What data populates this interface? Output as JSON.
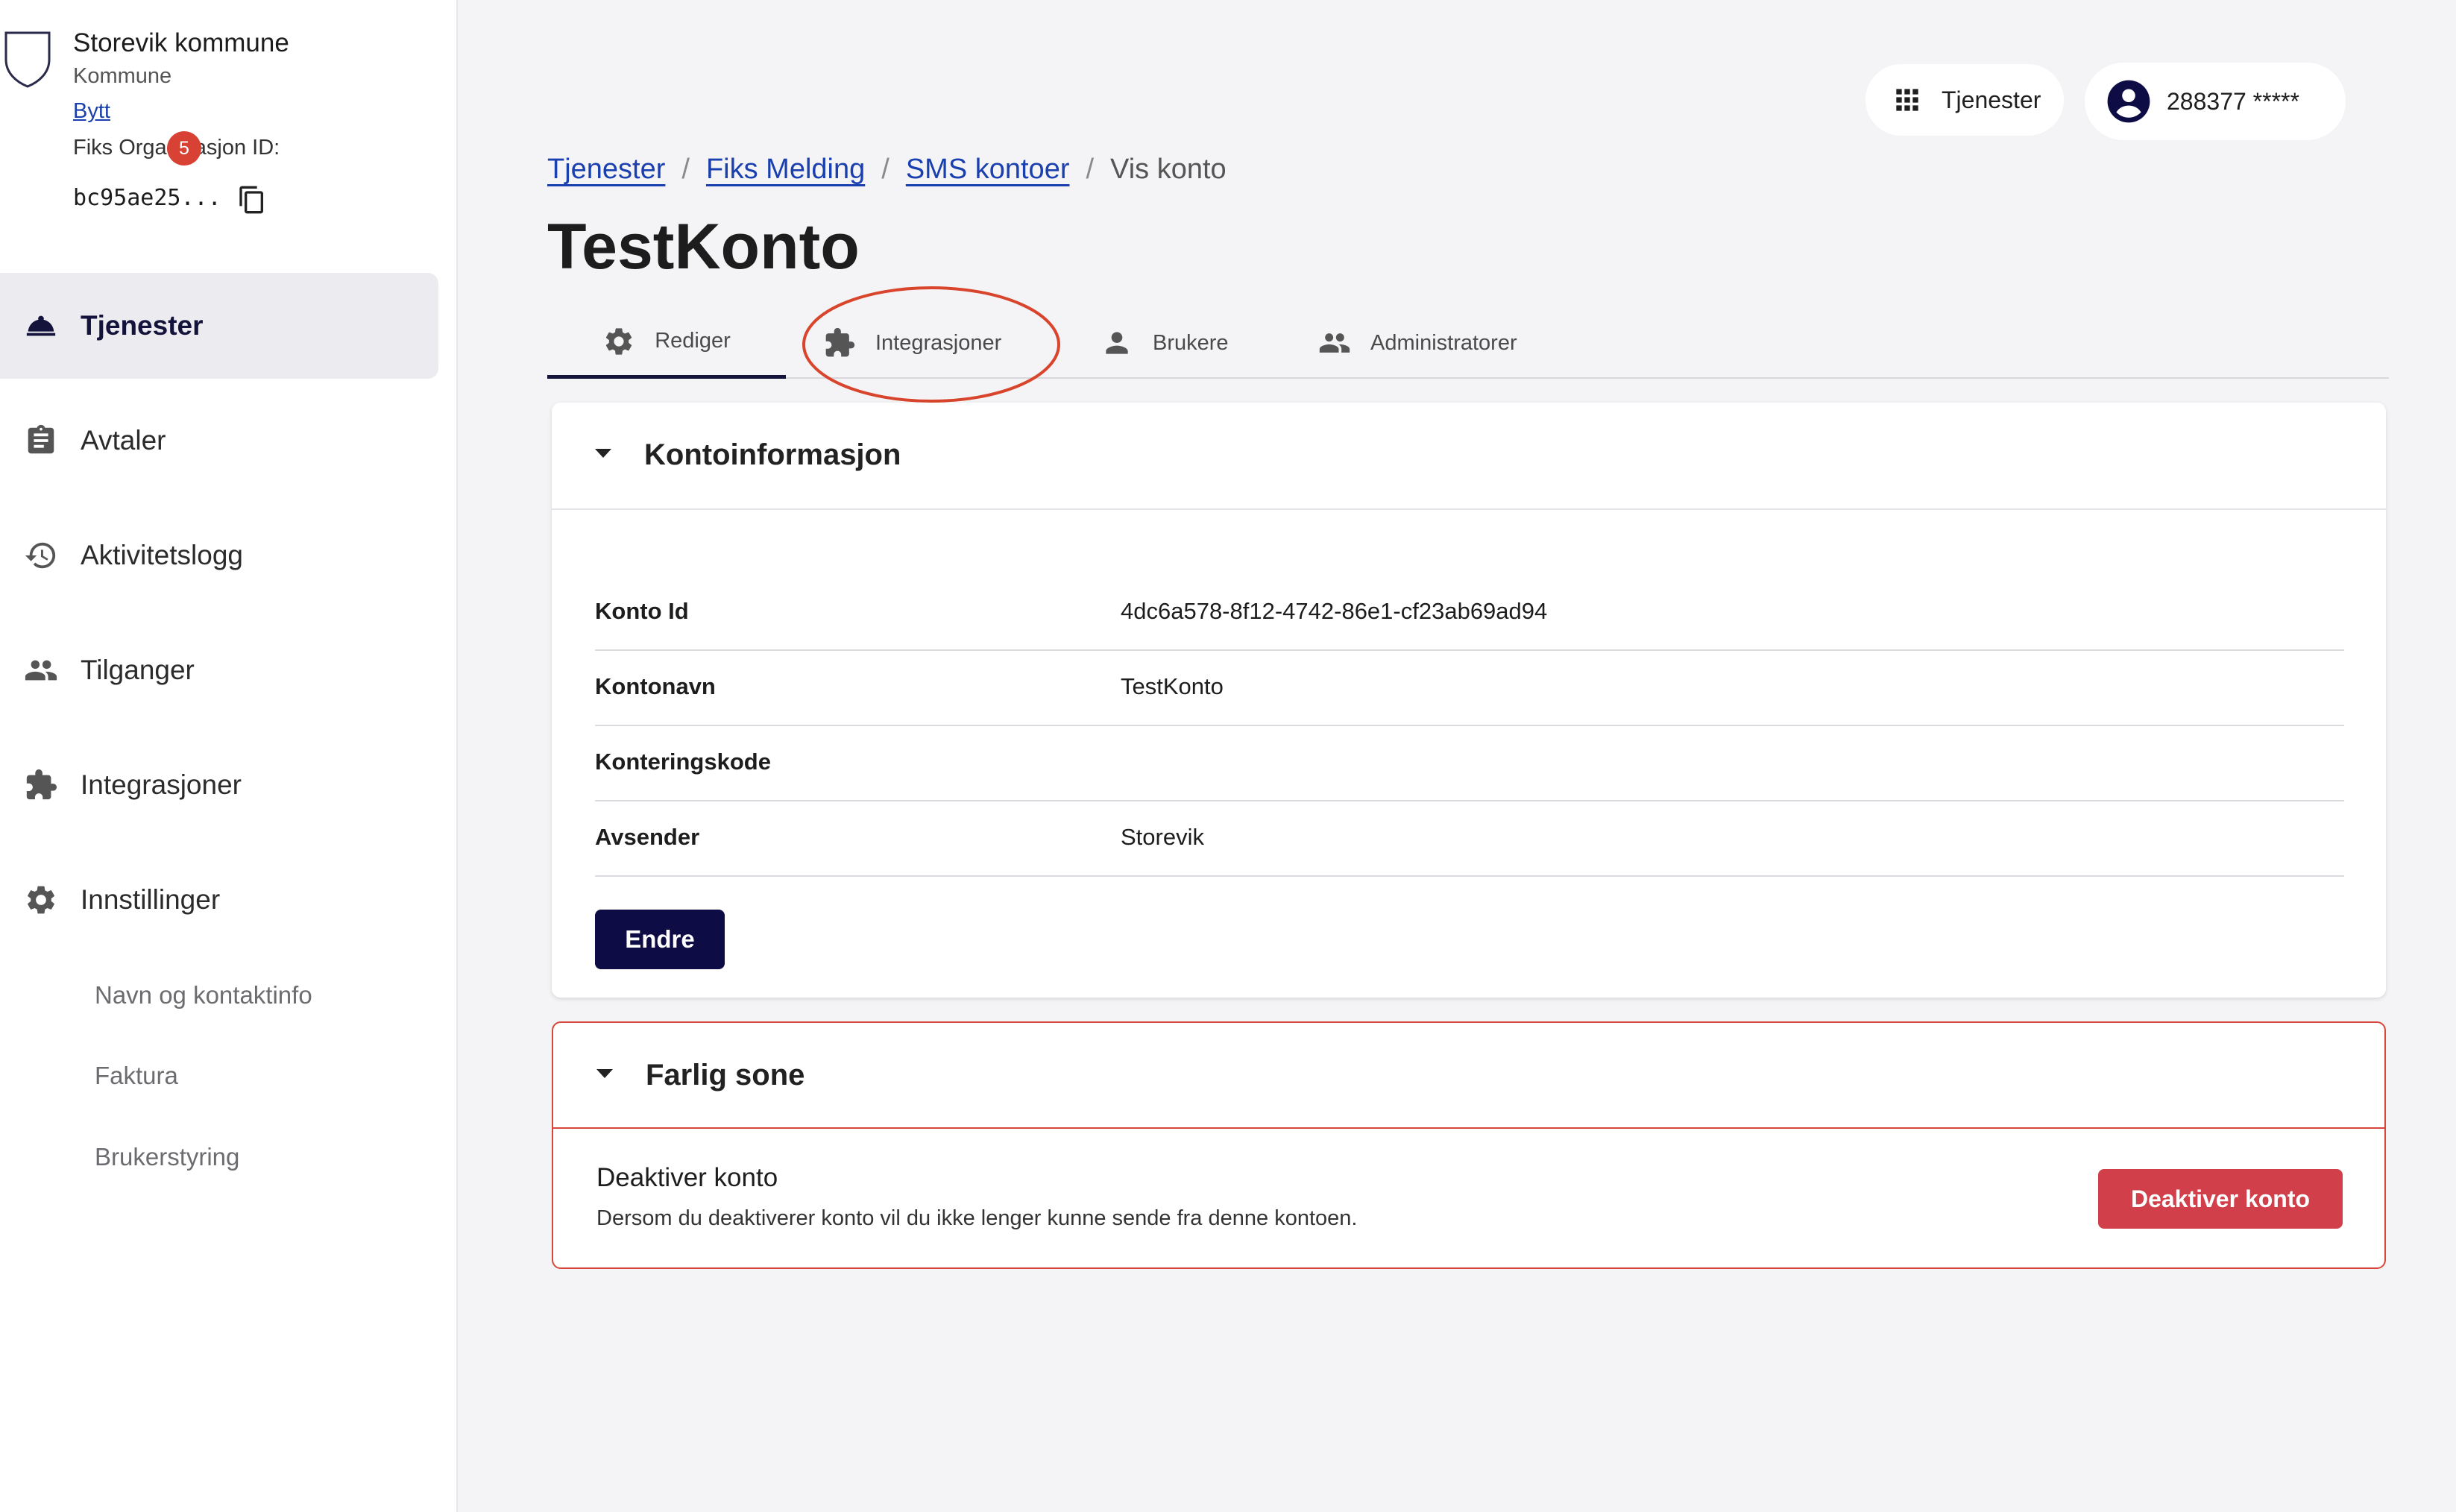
{
  "org": {
    "name": "Storevik kommune",
    "type": "Kommune",
    "switch_label": "Bytt",
    "id_label": "Fiks Organisasjon ID:",
    "id_value": "bc95ae25..."
  },
  "sidebar": {
    "items": [
      {
        "label": "Tjenester",
        "icon": "service-bell-icon",
        "active": true
      },
      {
        "label": "Avtaler",
        "icon": "clipboard-icon",
        "badge": "5"
      },
      {
        "label": "Aktivitetslogg",
        "icon": "history-icon"
      },
      {
        "label": "Tilganger",
        "icon": "people-icon"
      },
      {
        "label": "Integrasjoner",
        "icon": "puzzle-icon"
      },
      {
        "label": "Innstillinger",
        "icon": "gear-icon"
      }
    ],
    "subitems": [
      {
        "label": "Navn og kontaktinfo"
      },
      {
        "label": "Faktura"
      },
      {
        "label": "Brukerstyring"
      }
    ]
  },
  "topbar": {
    "services_label": "Tjenester",
    "user_label": "288377 *****"
  },
  "breadcrumb": {
    "items": [
      {
        "label": "Tjenester"
      },
      {
        "label": "Fiks Melding"
      },
      {
        "label": "SMS kontoer"
      }
    ],
    "current": "Vis konto"
  },
  "page": {
    "title": "TestKonto"
  },
  "tabs": [
    {
      "label": "Rediger",
      "icon": "gear-icon",
      "active": true
    },
    {
      "label": "Integrasjoner",
      "icon": "puzzle-icon",
      "highlighted": true
    },
    {
      "label": "Brukere",
      "icon": "person-icon"
    },
    {
      "label": "Administratorer",
      "icon": "people-icon"
    }
  ],
  "account_info": {
    "title": "Kontoinformasjon",
    "rows": [
      {
        "key": "Konto Id",
        "value": "4dc6a578-8f12-4742-86e1-cf23ab69ad94"
      },
      {
        "key": "Kontonavn",
        "value": "TestKonto"
      },
      {
        "key": "Konteringskode",
        "value": ""
      },
      {
        "key": "Avsender",
        "value": "Storevik"
      }
    ],
    "edit_button": "Endre"
  },
  "danger_zone": {
    "title": "Farlig sone",
    "deactivate_title": "Deaktiver konto",
    "deactivate_description": "Dersom du deaktiverer konto vil du ikke lenger kunne sende fra denne kontoen.",
    "deactivate_button": "Deaktiver konto"
  },
  "colors": {
    "primary": "#0e0c45",
    "danger": "#d1404a",
    "link": "#1a3fae",
    "badge": "#d74234",
    "highlight_annotation": "#d9452c"
  }
}
